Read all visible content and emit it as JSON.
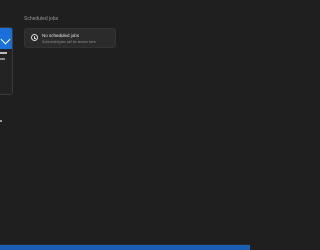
{
  "section": {
    "title": "Scheduled jobs"
  },
  "job": {
    "title": "No scheduled jobs",
    "subtitle": "Scheduled jobs will be shown here",
    "icon": "clock-icon"
  },
  "colors": {
    "accent": "#1a6fd8",
    "background": "#1f1f1f",
    "card": "#2b2b2b"
  }
}
